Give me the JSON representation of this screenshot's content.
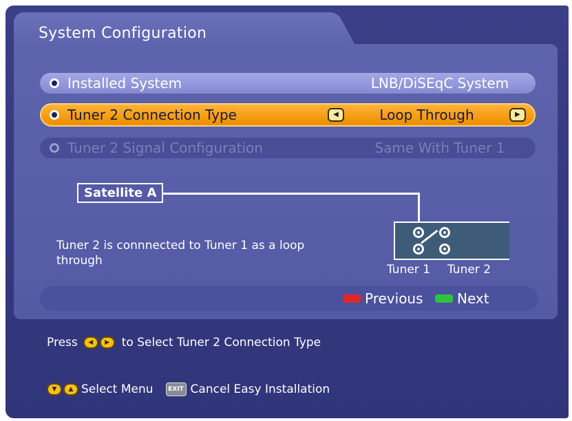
{
  "window": {
    "title": "System Configuration"
  },
  "menu": {
    "rows": [
      {
        "label": "Installed System",
        "value": "LNB/DiSEqC System",
        "state": "normal"
      },
      {
        "label": "Tuner 2 Connection Type",
        "value": "Loop Through",
        "state": "selected"
      },
      {
        "label": "Tuner 2 Signal Configuration",
        "value": "Same With Tuner 1",
        "state": "disabled"
      }
    ]
  },
  "diagram": {
    "satellite_label": "Satellite A",
    "description": "Tuner 2 is connnected to Tuner 1 as a loop through",
    "tuner1_label": "Tuner 1",
    "tuner2_label": "Tuner 2"
  },
  "nav": {
    "previous_label": "Previous",
    "next_label": "Next",
    "previous_key_color": "#e0262b",
    "next_key_color": "#2fc23c"
  },
  "hints": {
    "press_text": "Press",
    "select_text": "to Select Tuner 2 Connection Type",
    "select_menu": "Select Menu",
    "exit_key": "EXIT",
    "cancel_text": "Cancel Easy Installation"
  },
  "colors": {
    "selected_row": "#f59c10",
    "background": "#3a3f86",
    "panel": "#5d63ad"
  }
}
